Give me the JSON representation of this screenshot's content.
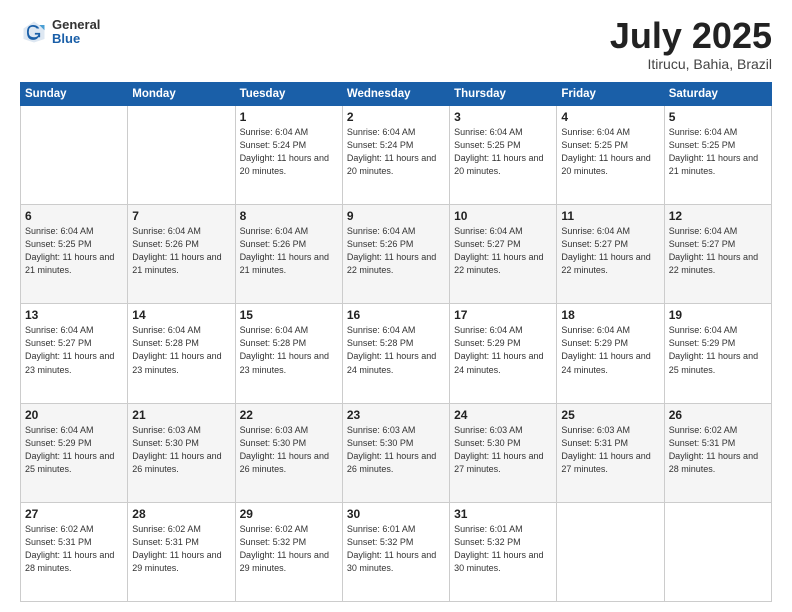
{
  "header": {
    "logo_general": "General",
    "logo_blue": "Blue",
    "title": "July 2025",
    "location": "Itirucu, Bahia, Brazil"
  },
  "days_of_week": [
    "Sunday",
    "Monday",
    "Tuesday",
    "Wednesday",
    "Thursday",
    "Friday",
    "Saturday"
  ],
  "weeks": [
    [
      {
        "day": "",
        "info": ""
      },
      {
        "day": "",
        "info": ""
      },
      {
        "day": "1",
        "info": "Sunrise: 6:04 AM\nSunset: 5:24 PM\nDaylight: 11 hours and 20 minutes."
      },
      {
        "day": "2",
        "info": "Sunrise: 6:04 AM\nSunset: 5:24 PM\nDaylight: 11 hours and 20 minutes."
      },
      {
        "day": "3",
        "info": "Sunrise: 6:04 AM\nSunset: 5:25 PM\nDaylight: 11 hours and 20 minutes."
      },
      {
        "day": "4",
        "info": "Sunrise: 6:04 AM\nSunset: 5:25 PM\nDaylight: 11 hours and 20 minutes."
      },
      {
        "day": "5",
        "info": "Sunrise: 6:04 AM\nSunset: 5:25 PM\nDaylight: 11 hours and 21 minutes."
      }
    ],
    [
      {
        "day": "6",
        "info": "Sunrise: 6:04 AM\nSunset: 5:25 PM\nDaylight: 11 hours and 21 minutes."
      },
      {
        "day": "7",
        "info": "Sunrise: 6:04 AM\nSunset: 5:26 PM\nDaylight: 11 hours and 21 minutes."
      },
      {
        "day": "8",
        "info": "Sunrise: 6:04 AM\nSunset: 5:26 PM\nDaylight: 11 hours and 21 minutes."
      },
      {
        "day": "9",
        "info": "Sunrise: 6:04 AM\nSunset: 5:26 PM\nDaylight: 11 hours and 22 minutes."
      },
      {
        "day": "10",
        "info": "Sunrise: 6:04 AM\nSunset: 5:27 PM\nDaylight: 11 hours and 22 minutes."
      },
      {
        "day": "11",
        "info": "Sunrise: 6:04 AM\nSunset: 5:27 PM\nDaylight: 11 hours and 22 minutes."
      },
      {
        "day": "12",
        "info": "Sunrise: 6:04 AM\nSunset: 5:27 PM\nDaylight: 11 hours and 22 minutes."
      }
    ],
    [
      {
        "day": "13",
        "info": "Sunrise: 6:04 AM\nSunset: 5:27 PM\nDaylight: 11 hours and 23 minutes."
      },
      {
        "day": "14",
        "info": "Sunrise: 6:04 AM\nSunset: 5:28 PM\nDaylight: 11 hours and 23 minutes."
      },
      {
        "day": "15",
        "info": "Sunrise: 6:04 AM\nSunset: 5:28 PM\nDaylight: 11 hours and 23 minutes."
      },
      {
        "day": "16",
        "info": "Sunrise: 6:04 AM\nSunset: 5:28 PM\nDaylight: 11 hours and 24 minutes."
      },
      {
        "day": "17",
        "info": "Sunrise: 6:04 AM\nSunset: 5:29 PM\nDaylight: 11 hours and 24 minutes."
      },
      {
        "day": "18",
        "info": "Sunrise: 6:04 AM\nSunset: 5:29 PM\nDaylight: 11 hours and 24 minutes."
      },
      {
        "day": "19",
        "info": "Sunrise: 6:04 AM\nSunset: 5:29 PM\nDaylight: 11 hours and 25 minutes."
      }
    ],
    [
      {
        "day": "20",
        "info": "Sunrise: 6:04 AM\nSunset: 5:29 PM\nDaylight: 11 hours and 25 minutes."
      },
      {
        "day": "21",
        "info": "Sunrise: 6:03 AM\nSunset: 5:30 PM\nDaylight: 11 hours and 26 minutes."
      },
      {
        "day": "22",
        "info": "Sunrise: 6:03 AM\nSunset: 5:30 PM\nDaylight: 11 hours and 26 minutes."
      },
      {
        "day": "23",
        "info": "Sunrise: 6:03 AM\nSunset: 5:30 PM\nDaylight: 11 hours and 26 minutes."
      },
      {
        "day": "24",
        "info": "Sunrise: 6:03 AM\nSunset: 5:30 PM\nDaylight: 11 hours and 27 minutes."
      },
      {
        "day": "25",
        "info": "Sunrise: 6:03 AM\nSunset: 5:31 PM\nDaylight: 11 hours and 27 minutes."
      },
      {
        "day": "26",
        "info": "Sunrise: 6:02 AM\nSunset: 5:31 PM\nDaylight: 11 hours and 28 minutes."
      }
    ],
    [
      {
        "day": "27",
        "info": "Sunrise: 6:02 AM\nSunset: 5:31 PM\nDaylight: 11 hours and 28 minutes."
      },
      {
        "day": "28",
        "info": "Sunrise: 6:02 AM\nSunset: 5:31 PM\nDaylight: 11 hours and 29 minutes."
      },
      {
        "day": "29",
        "info": "Sunrise: 6:02 AM\nSunset: 5:32 PM\nDaylight: 11 hours and 29 minutes."
      },
      {
        "day": "30",
        "info": "Sunrise: 6:01 AM\nSunset: 5:32 PM\nDaylight: 11 hours and 30 minutes."
      },
      {
        "day": "31",
        "info": "Sunrise: 6:01 AM\nSunset: 5:32 PM\nDaylight: 11 hours and 30 minutes."
      },
      {
        "day": "",
        "info": ""
      },
      {
        "day": "",
        "info": ""
      }
    ]
  ]
}
